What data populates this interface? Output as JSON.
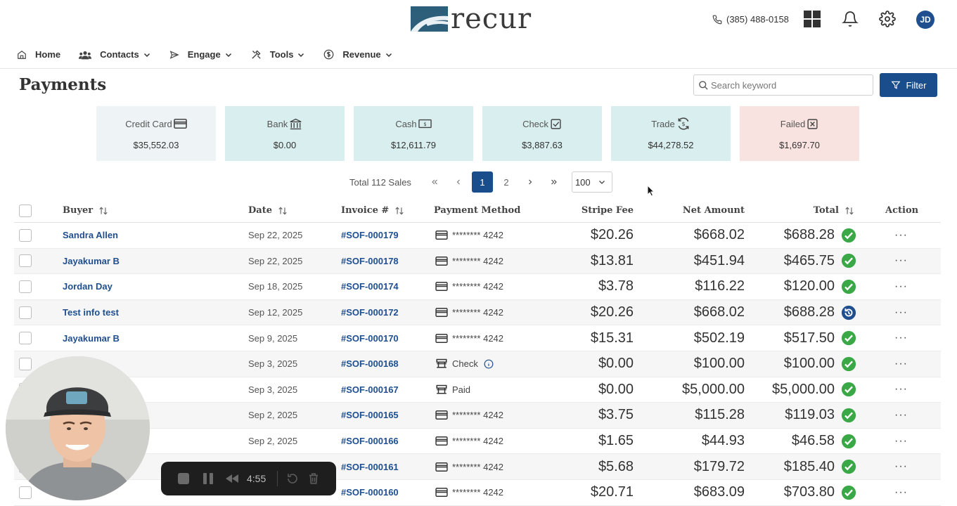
{
  "header": {
    "logo_text": "recur",
    "phone": "(385) 488-0158",
    "avatar_initials": "JD"
  },
  "nav": {
    "items": [
      {
        "label": "Home",
        "icon": "home-icon",
        "dropdown": false
      },
      {
        "label": "Contacts",
        "icon": "contacts-icon",
        "dropdown": true
      },
      {
        "label": "Engage",
        "icon": "send-icon",
        "dropdown": true
      },
      {
        "label": "Tools",
        "icon": "tools-icon",
        "dropdown": true
      },
      {
        "label": "Revenue",
        "icon": "dollar-icon",
        "dropdown": true
      }
    ]
  },
  "page": {
    "title": "Payments",
    "search_placeholder": "Search keyword",
    "filter_label": "Filter"
  },
  "summary_cards": [
    {
      "label": "Credit Card",
      "amount": "$35,552.03",
      "icon": "credit-card-icon",
      "bg": "#eef4f6"
    },
    {
      "label": "Bank",
      "amount": "$0.00",
      "icon": "bank-icon",
      "bg": "#d9eeee"
    },
    {
      "label": "Cash",
      "amount": "$12,611.79",
      "icon": "cash-icon",
      "bg": "#d9eeee"
    },
    {
      "label": "Check",
      "amount": "$3,887.63",
      "icon": "check-box-icon",
      "bg": "#d9eeee"
    },
    {
      "label": "Trade",
      "amount": "$44,278.52",
      "icon": "trade-icon",
      "bg": "#d9eeee"
    },
    {
      "label": "Failed",
      "amount": "$1,697.70",
      "icon": "failed-icon",
      "bg": "#f8e3e0"
    }
  ],
  "pagination": {
    "total_text": "Total 112 Sales",
    "pages": [
      "1",
      "2"
    ],
    "active_page": "1",
    "per_page": "100"
  },
  "table": {
    "headers": {
      "buyer": "Buyer",
      "date": "Date",
      "invoice": "Invoice #",
      "payment_method": "Payment Method",
      "stripe_fee": "Stripe Fee",
      "net_amount": "Net Amount",
      "total": "Total",
      "action": "Action"
    },
    "rows": [
      {
        "buyer": "Sandra Allen",
        "date": "Sep 22, 2025",
        "invoice": "#SOF-000179",
        "method": "******** 4242",
        "method_type": "card",
        "fee": "$20.26",
        "net": "$668.02",
        "total": "$688.28",
        "status": "paid"
      },
      {
        "buyer": "Jayakumar B",
        "date": "Sep 22, 2025",
        "invoice": "#SOF-000178",
        "method": "******** 4242",
        "method_type": "card",
        "fee": "$13.81",
        "net": "$451.94",
        "total": "$465.75",
        "status": "paid"
      },
      {
        "buyer": "Jordan Day",
        "date": "Sep 18, 2025",
        "invoice": "#SOF-000174",
        "method": "******** 4242",
        "method_type": "card",
        "fee": "$3.78",
        "net": "$116.22",
        "total": "$120.00",
        "status": "paid"
      },
      {
        "buyer": "Test info test",
        "date": "Sep 12, 2025",
        "invoice": "#SOF-000172",
        "method": "******** 4242",
        "method_type": "card",
        "fee": "$20.26",
        "net": "$668.02",
        "total": "$688.28",
        "status": "pending"
      },
      {
        "buyer": "Jayakumar B",
        "date": "Sep 9, 2025",
        "invoice": "#SOF-000170",
        "method": "******** 4242",
        "method_type": "card",
        "fee": "$15.31",
        "net": "$502.19",
        "total": "$517.50",
        "status": "paid"
      },
      {
        "buyer": "",
        "date": "Sep 3, 2025",
        "invoice": "#SOF-000168",
        "method": "Check",
        "method_type": "bank-info",
        "fee": "$0.00",
        "net": "$100.00",
        "total": "$100.00",
        "status": "paid"
      },
      {
        "buyer": "",
        "date": "Sep 3, 2025",
        "invoice": "#SOF-000167",
        "method": "Paid",
        "method_type": "bank",
        "fee": "$0.00",
        "net": "$5,000.00",
        "total": "$5,000.00",
        "status": "paid"
      },
      {
        "buyer": "",
        "date": "Sep 2, 2025",
        "invoice": "#SOF-000165",
        "method": "******** 4242",
        "method_type": "card",
        "fee": "$3.75",
        "net": "$115.28",
        "total": "$119.03",
        "status": "paid"
      },
      {
        "buyer": "",
        "date": "Sep 2, 2025",
        "invoice": "#SOF-000166",
        "method": "******** 4242",
        "method_type": "card",
        "fee": "$1.65",
        "net": "$44.93",
        "total": "$46.58",
        "status": "paid"
      },
      {
        "buyer": "",
        "date": "",
        "invoice": "#SOF-000161",
        "method": "******** 4242",
        "method_type": "card",
        "fee": "$5.68",
        "net": "$179.72",
        "total": "$185.40",
        "status": "paid"
      },
      {
        "buyer": "",
        "date": "",
        "invoice": "#SOF-000160",
        "method": "******** 4242",
        "method_type": "card",
        "fee": "$20.71",
        "net": "$683.09",
        "total": "$703.80",
        "status": "paid"
      }
    ],
    "action_glyph": "···"
  },
  "recorder": {
    "time": "4:55"
  },
  "colors": {
    "brand": "#1a4d8c",
    "link": "#1f4f8f",
    "success": "#3aa847",
    "pending": "#1f4f8f"
  }
}
